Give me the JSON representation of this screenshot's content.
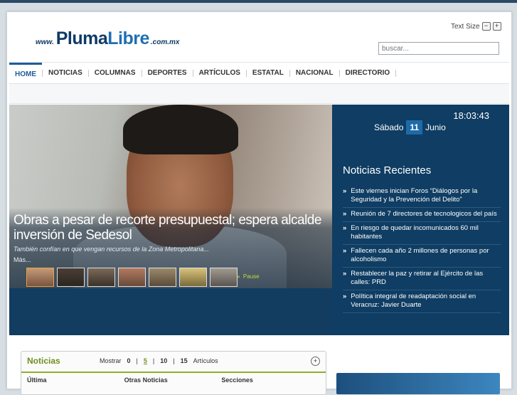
{
  "header": {
    "logo": {
      "www": "www.",
      "pluma": "Pluma",
      "libre": "Libre",
      "tld": ".com.mx"
    },
    "text_size_label": "Text Size",
    "text_size_minus": "−",
    "text_size_plus": "+",
    "search_placeholder": "buscar..."
  },
  "nav": {
    "items": [
      "HOME",
      "NOTICIAS",
      "COLUMNAS",
      "DEPORTES",
      "ARTÍCULOS",
      "ESTATAL",
      "NACIONAL",
      "DIRECTORIO"
    ],
    "active_index": 0
  },
  "slideshow": {
    "headline": "Obras a pesar de recorte presupuestal; espera alcalde inversión de Sedesol",
    "teaser": "También confían en que vengan recursos de la Zona Metropolitana...",
    "more": "Más...",
    "pause": "Pause",
    "thumb_count": 7
  },
  "sidebar": {
    "time": "18:03:43",
    "weekday": "Sábado",
    "day": "11",
    "month": "Junio",
    "recent_title": "Noticias Recientes",
    "recent": [
      "Este viernes inician Foros “Diálogos por la Seguridad y la Prevención del Delito”",
      "Reunión de 7 directores de tecnologicos del país",
      "En riesgo de quedar incomunicados 60 mil habitantes",
      "Fallecen cada año 2 millones de personas por alcoholismo",
      "Restablecer la paz y retirar al Ejército de las calles: PRD",
      "Política integral de readaptación social en Veracruz: Javier Duarte"
    ]
  },
  "noticias_box": {
    "title": "Noticias",
    "mostrar": "Mostrar",
    "counts": [
      "0",
      "5",
      "10",
      "15"
    ],
    "selected_count": "5",
    "articulos": "Artículos",
    "tabs": [
      "Última",
      "Otras Noticias",
      "Secciones"
    ],
    "expand": "+"
  },
  "colors": {
    "brand": "#0e3a66",
    "accent": "#1f6fb3",
    "panel": "#0f3d63",
    "green": "#6f8f1e"
  }
}
